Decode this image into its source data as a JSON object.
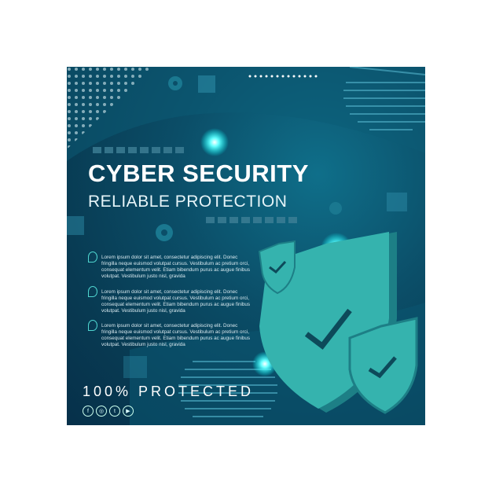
{
  "title": "CYBER SECURITY",
  "subtitle": "RELIABLE PROTECTION",
  "paragraphs": [
    "Lorem ipsum dolor sit amet, consectetur adipiscing elit. Donec fringilla neque euismod volutpat cursus. Vestibulum ac pretium orci, consequat elementum velit. Etiam bibendum purus ac augue finibus volutpat. Vestibulum justo nisl, gravida",
    "Lorem ipsum dolor sit amet, consectetur adipiscing elit. Donec fringilla neque euismod volutpat cursus. Vestibulum ac pretium orci, consequat elementum velit. Etiam bibendum purus ac augue finibus volutpat. Vestibulum justo nisl, gravida",
    "Lorem ipsum dolor sit amet, consectetur adipiscing elit. Donec fringilla neque euismod volutpat cursus. Vestibulum ac pretium orci, consequat elementum velit. Etiam bibendum purus ac augue finibus volutpat. Vestibulum justo nisl, gravida"
  ],
  "tagline": "100% PROTECTED",
  "social": [
    {
      "icon": "facebook-icon",
      "glyph": "f"
    },
    {
      "icon": "instagram-icon",
      "glyph": "◎"
    },
    {
      "icon": "twitter-icon",
      "glyph": "t"
    },
    {
      "icon": "youtube-icon",
      "glyph": "▶"
    }
  ],
  "colors": {
    "background": "#0b4e68",
    "shield": "#2fa9a6",
    "accent": "#4fd6d0"
  }
}
